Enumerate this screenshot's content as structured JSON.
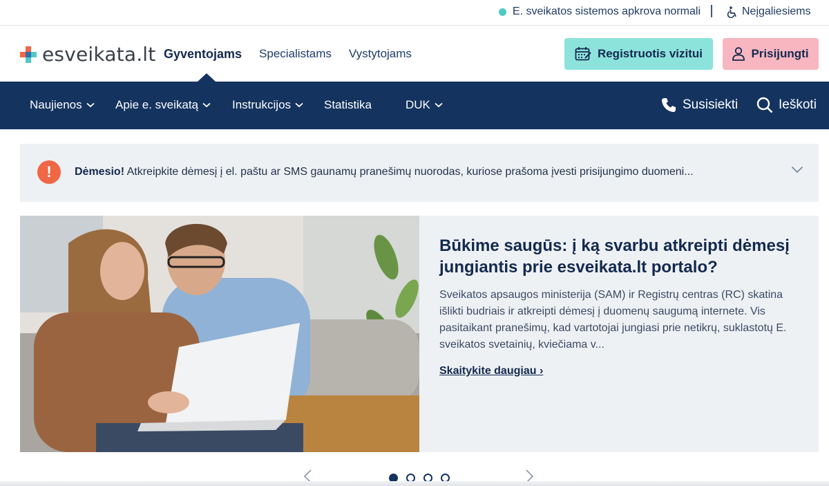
{
  "topbar": {
    "status_text": "E. sveikatos sistemos apkrova normali",
    "status_color": "#4fc9c2",
    "disability_label": "Neįgaliesiems"
  },
  "header": {
    "logo_text": "esveikata.lt",
    "nav": [
      {
        "label": "Gyventojams",
        "active": true
      },
      {
        "label": "Specialistams",
        "active": false
      },
      {
        "label": "Vystytojams",
        "active": false
      }
    ],
    "register_label": "Registruotis vizitui",
    "login_label": "Prisijungti",
    "register_color": "#8ce3dc",
    "login_color": "#f7b6c0"
  },
  "subnav": {
    "background": "#14335f",
    "items": [
      {
        "label": "Naujienos",
        "dropdown": true
      },
      {
        "label": "Apie e. sveikatą",
        "dropdown": true
      },
      {
        "label": "Instrukcijos",
        "dropdown": true
      },
      {
        "label": "Statistika",
        "dropdown": false
      },
      {
        "label": "DUK",
        "dropdown": true
      }
    ],
    "contact_label": "Susisiekti",
    "search_label": "Ieškoti"
  },
  "alert": {
    "prefix": "Dėmesio!",
    "text": " Atkreipkite dėmesį į el. paštu ar SMS gaunamų pranešimų nuorodas, kuriose prašoma įvesti prisijungimo duomeni..."
  },
  "hero": {
    "title": "Būkime saugūs: į ką svarbu atkreipti dėmesį jungiantis prie esveikata.lt portalo?",
    "description": "Sveikatos apsaugos ministerija (SAM) ir Registrų centras (RC) skatina išlikti budriais ir atkreipti dėmesį į duomenų saugumą internete. Vis pasitaikant pranešimų, kad vartotojai jungiasi prie netikrų, suklastotų E. sveikatos svetainių, kviečiama v...",
    "link_label": "Skaitykite daugiau ›"
  },
  "carousel": {
    "slides": 4,
    "active_index": 0
  }
}
